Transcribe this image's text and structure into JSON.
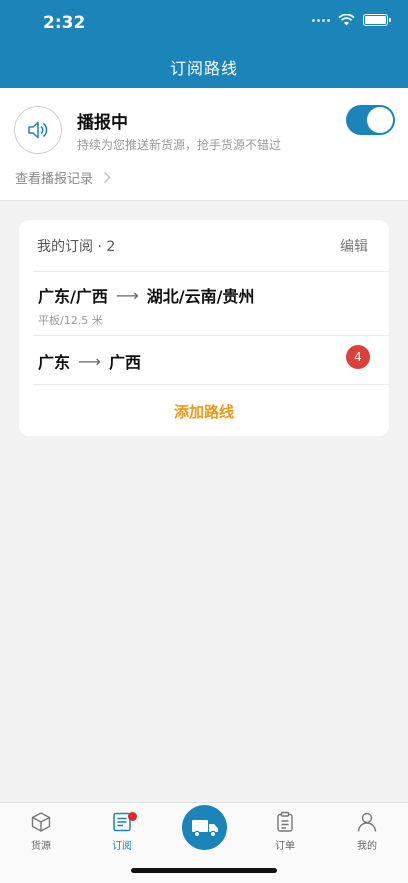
{
  "status": {
    "time": "2:32"
  },
  "header": {
    "title": "订阅路线"
  },
  "broadcast": {
    "title": "播报中",
    "subtitle": "持续为您推送新货源，抢手货源不错过",
    "enabled": true,
    "history_label": "查看播报记录"
  },
  "subscriptions": {
    "title": "我的订阅 · 2",
    "edit_label": "编辑",
    "routes": [
      {
        "from": "广东/广西",
        "arrow": "⟶",
        "to": "湖北/云南/贵州",
        "detail": "平板/12.5 米"
      },
      {
        "from": "广东",
        "arrow": "⟶",
        "to": "广西",
        "badge": "4"
      }
    ],
    "add_label": "添加路线"
  },
  "tabs": [
    {
      "label": "货源",
      "icon": "box-icon"
    },
    {
      "label": "订阅",
      "icon": "subscribe-icon"
    },
    {
      "label": "",
      "icon": "truck-icon"
    },
    {
      "label": "订单",
      "icon": "clipboard-icon"
    },
    {
      "label": "我的",
      "icon": "user-icon"
    }
  ],
  "colors": {
    "primary": "#1b84b8",
    "accent": "#e99a1b",
    "badge": "#d9413a"
  }
}
